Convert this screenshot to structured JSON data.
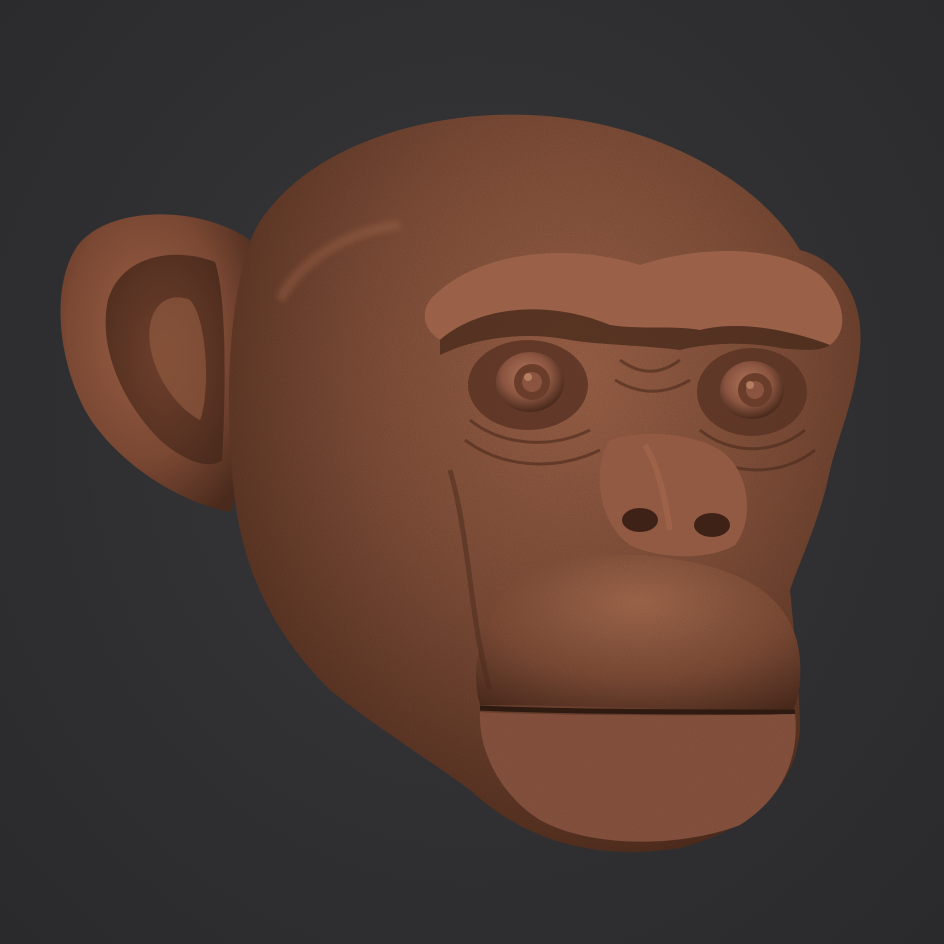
{
  "scene": {
    "subject": "chimpanzee-head-sculpt",
    "colors": {
      "background": "#2e2e30",
      "clay_base": "#7a4a35",
      "clay_highlight": "#a86a4e",
      "clay_shadow": "#3e2218"
    }
  }
}
